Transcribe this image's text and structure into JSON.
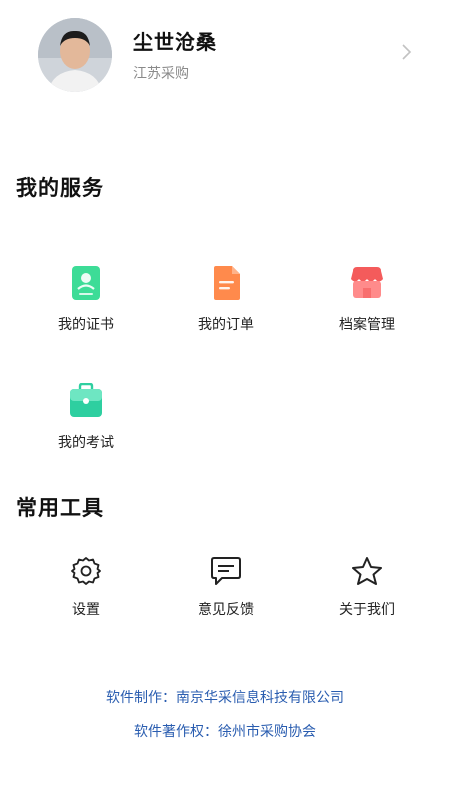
{
  "profile": {
    "name": "尘世沧桑",
    "organization": "江苏采购"
  },
  "services": {
    "title": "我的服务",
    "items": [
      {
        "label": "我的证书",
        "icon": "certificate-icon"
      },
      {
        "label": "我的订单",
        "icon": "order-icon"
      },
      {
        "label": "档案管理",
        "icon": "archive-icon"
      },
      {
        "label": "我的考试",
        "icon": "exam-icon"
      }
    ]
  },
  "tools": {
    "title": "常用工具",
    "items": [
      {
        "label": "设置",
        "icon": "gear-icon"
      },
      {
        "label": "意见反馈",
        "icon": "feedback-icon"
      },
      {
        "label": "关于我们",
        "icon": "star-icon"
      }
    ]
  },
  "footer": {
    "producer": "软件制作：南京华采信息科技有限公司",
    "copyright": "软件著作权：徐州市采购协会"
  },
  "colors": {
    "accent_link": "#2a5db0",
    "certificate": "#3ddc97",
    "order": "#ff8a4c",
    "archive": "#f45b5b",
    "exam": "#2ecfa0"
  }
}
